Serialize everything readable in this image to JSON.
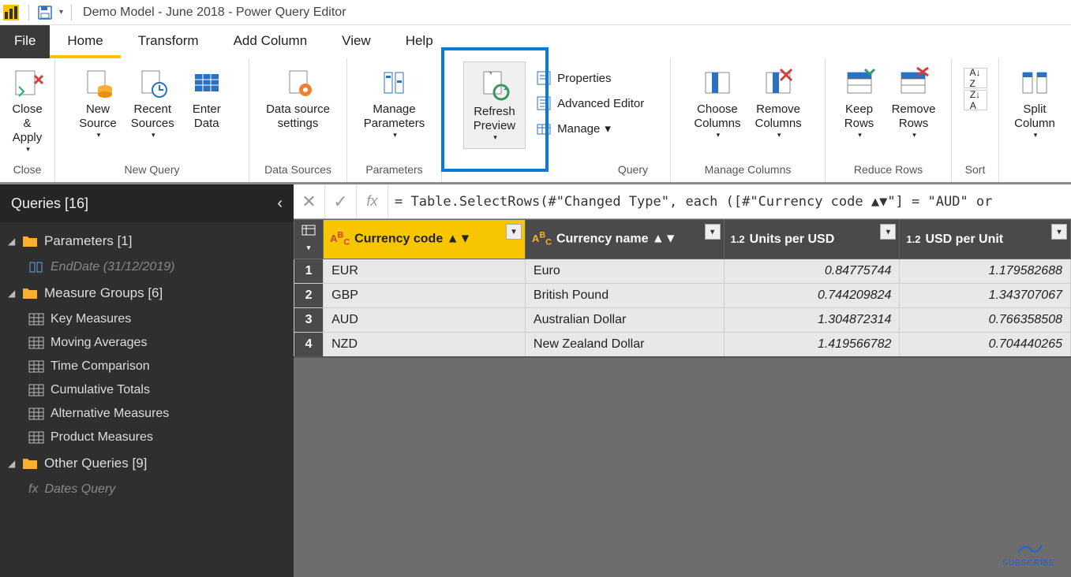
{
  "title": "Demo Model - June 2018 - Power Query Editor",
  "tabs": {
    "file": "File",
    "home": "Home",
    "transform": "Transform",
    "addcol": "Add Column",
    "view": "View",
    "help": "Help"
  },
  "ribbon": {
    "close": {
      "closeapply": "Close &\nApply",
      "group": "Close"
    },
    "newquery": {
      "newsource": "New\nSource",
      "recent": "Recent\nSources",
      "enter": "Enter\nData",
      "group": "New Query"
    },
    "datasources": {
      "settings": "Data source\nsettings",
      "group": "Data Sources"
    },
    "parameters": {
      "manage": "Manage\nParameters",
      "group": "Parameters"
    },
    "query": {
      "refresh": "Refresh\nPreview",
      "props": "Properties",
      "adv": "Advanced Editor",
      "mng": "Manage",
      "group": "Query"
    },
    "managecols": {
      "choose": "Choose\nColumns",
      "remove": "Remove\nColumns",
      "group": "Manage Columns"
    },
    "reducerows": {
      "keep": "Keep\nRows",
      "remove": "Remove\nRows",
      "group": "Reduce Rows"
    },
    "sort": {
      "group": "Sort"
    },
    "split": {
      "split": "Split\nColumn"
    }
  },
  "sidebar": {
    "header": "Queries [16]",
    "folders": [
      {
        "name": "Parameters [1]",
        "items": [
          {
            "label": "EndDate (31/12/2019)",
            "type": "param"
          }
        ]
      },
      {
        "name": "Measure Groups [6]",
        "items": [
          {
            "label": "Key Measures",
            "type": "table"
          },
          {
            "label": "Moving Averages",
            "type": "table"
          },
          {
            "label": "Time Comparison",
            "type": "table"
          },
          {
            "label": "Cumulative Totals",
            "type": "table"
          },
          {
            "label": "Alternative Measures",
            "type": "table"
          },
          {
            "label": "Product Measures",
            "type": "table"
          }
        ]
      },
      {
        "name": "Other Queries [9]",
        "items": [
          {
            "label": "Dates Query",
            "type": "fx"
          }
        ]
      }
    ]
  },
  "formula": "= Table.SelectRows(#\"Changed Type\", each ([#\"Currency code ▲▼\"] = \"AUD\" or",
  "columns": [
    {
      "label": "Currency code ▲▼",
      "type": "ABC",
      "selected": true,
      "filtered": true
    },
    {
      "label": "Currency name ▲▼",
      "type": "ABC"
    },
    {
      "label": "Units per USD",
      "type": "1.2",
      "numeric": true
    },
    {
      "label": "USD per Unit",
      "type": "1.2",
      "numeric": true
    }
  ],
  "rows": [
    {
      "n": "1",
      "c0": "EUR",
      "c1": "Euro",
      "c2": "0.84775744",
      "c3": "1.179582688"
    },
    {
      "n": "2",
      "c0": "GBP",
      "c1": "British Pound",
      "c2": "0.744209824",
      "c3": "1.343707067"
    },
    {
      "n": "3",
      "c0": "AUD",
      "c1": "Australian Dollar",
      "c2": "1.304872314",
      "c3": "0.766358508"
    },
    {
      "n": "4",
      "c0": "NZD",
      "c1": "New Zealand Dollar",
      "c2": "1.419566782",
      "c3": "0.704440265"
    }
  ],
  "subscribe": "SUBSCRIBE"
}
